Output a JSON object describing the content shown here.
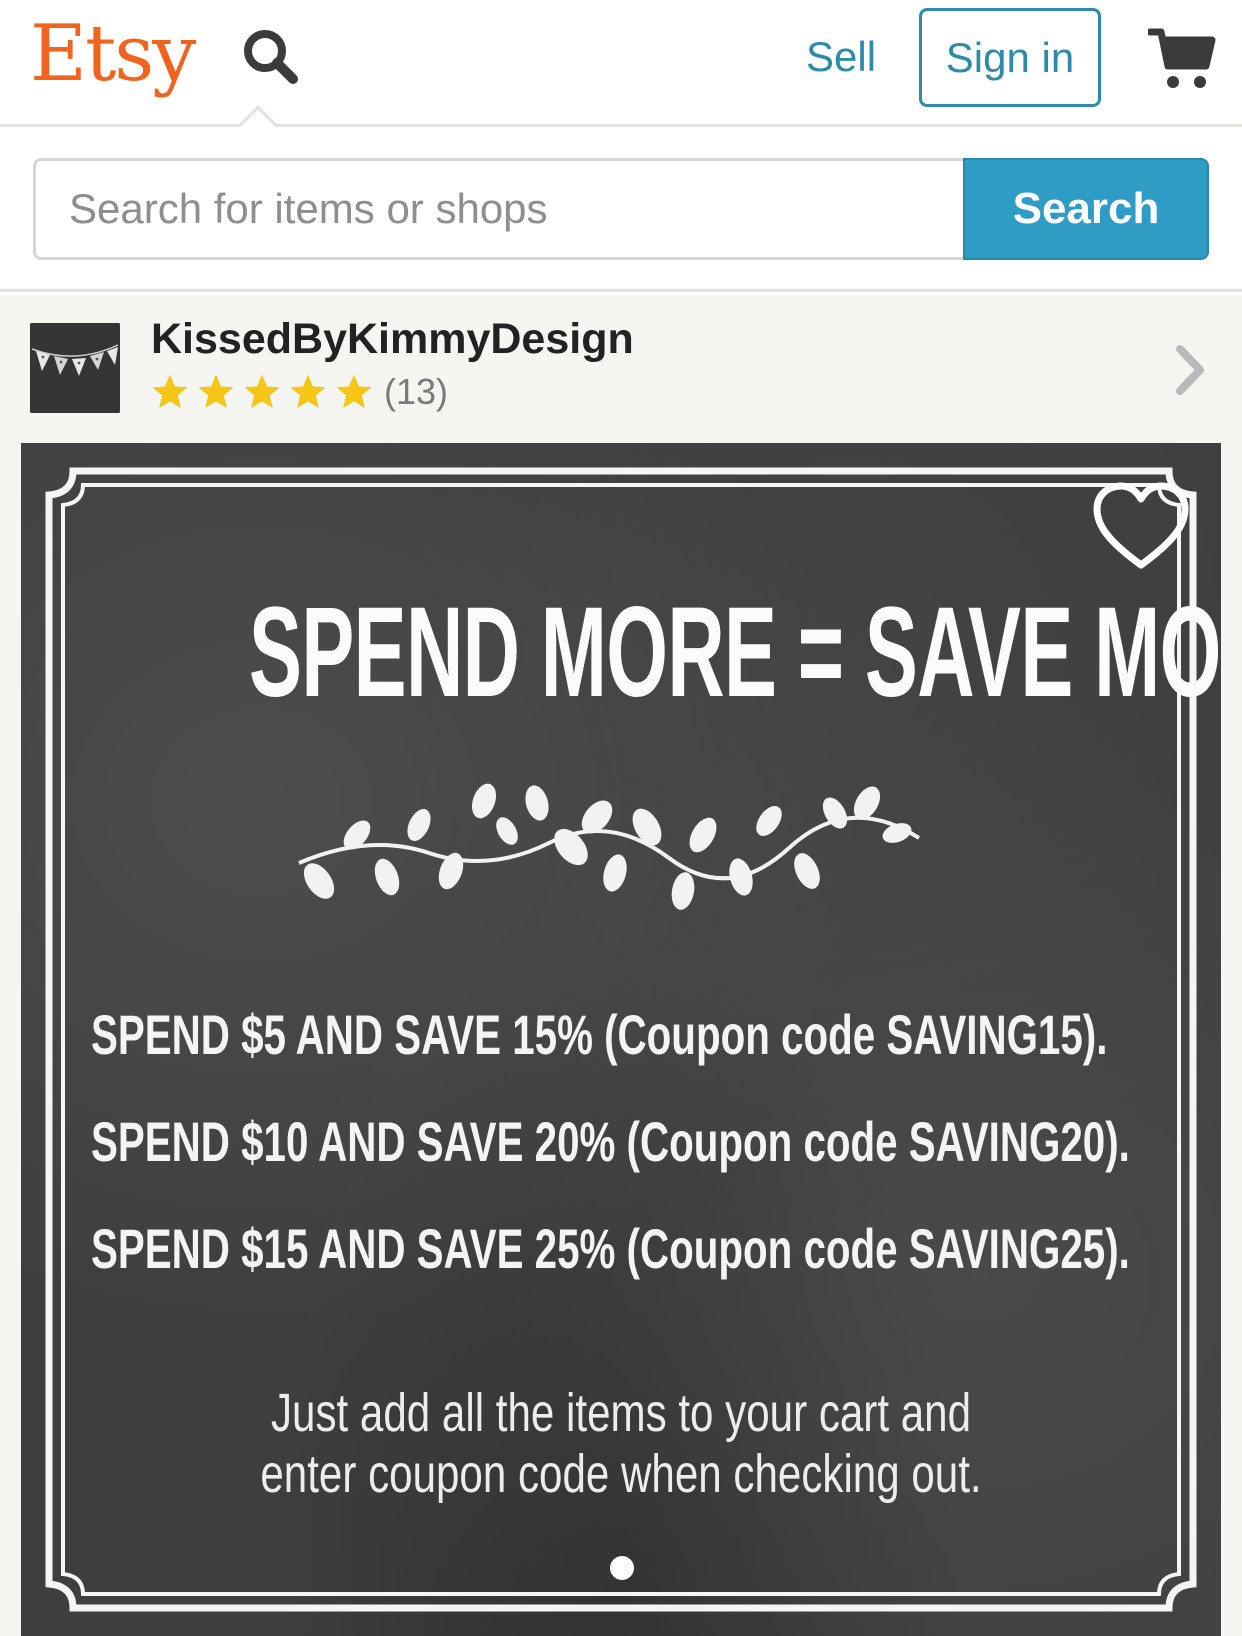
{
  "header": {
    "logo": "Etsy",
    "sell_label": "Sell",
    "signin_label": "Sign in",
    "search_icon": "search-icon",
    "cart_icon": "cart-icon"
  },
  "search": {
    "placeholder": "Search for items or shops",
    "value": "",
    "button_label": "Search"
  },
  "shop": {
    "name": "KissedByKimmyDesign",
    "rating_stars": 5,
    "review_count": "(13)",
    "avatar_icon": "bunting-avatar-icon",
    "chevron_icon": "chevron-right-icon"
  },
  "listing": {
    "headline": "SPEND MORE = SAVE MORE",
    "offers": [
      "SPEND $5 AND SAVE 15%  (Coupon code SAVING15).",
      "SPEND $10 AND SAVE 20%  (Coupon code SAVING20).",
      "SPEND $15 AND SAVE 25%  (Coupon code SAVING25)."
    ],
    "note": [
      "Just add all the items to your cart and",
      "enter coupon code when checking out."
    ],
    "favorite_icon": "heart-icon",
    "carousel": {
      "current": 1
    }
  },
  "colors": {
    "brand_orange": "#f1641e",
    "link_teal": "#2b8ba8",
    "search_button": "#2e9cc5",
    "star_yellow": "#f5c518",
    "chalkboard": "#3e3e3e"
  }
}
